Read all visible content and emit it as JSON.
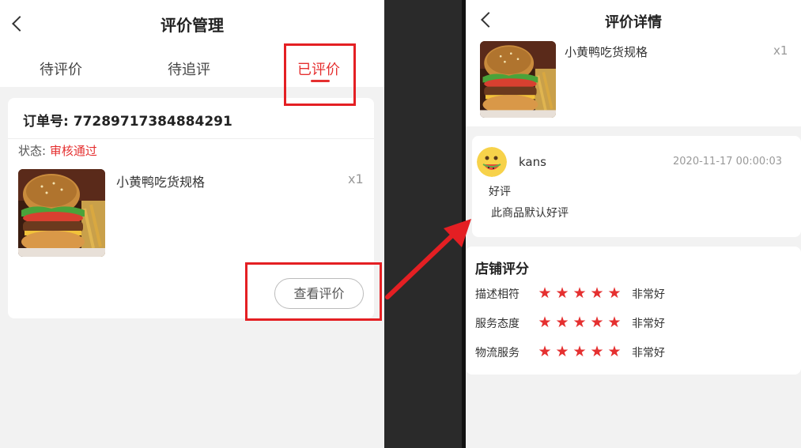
{
  "left": {
    "title": "评价管理",
    "tabs": [
      {
        "label": "待评价",
        "active": false
      },
      {
        "label": "待追评",
        "active": false
      },
      {
        "label": "已评价",
        "active": true
      }
    ],
    "order": {
      "number": "订单号: 77289717384884291",
      "status_label": "状态:",
      "status_value": "审核通过",
      "product_name": "小黄鸭吃货规格",
      "quantity": "x1",
      "view_button": "查看评价"
    }
  },
  "right": {
    "title": "评价详情",
    "product_name": "小黄鸭吃货规格",
    "quantity": "x1",
    "review": {
      "user": "kans",
      "date": "2020-11-17 00:00:03",
      "rating": "好评",
      "content": "此商品默认好评"
    },
    "shop_rating": {
      "title": "店铺评分",
      "rows": [
        {
          "label": "描述相符",
          "stars": 5,
          "text": "非常好"
        },
        {
          "label": "服务态度",
          "stars": 5,
          "text": "非常好"
        },
        {
          "label": "物流服务",
          "stars": 5,
          "text": "非常好"
        }
      ]
    }
  },
  "colors": {
    "accent": "#e53030",
    "highlight": "#e41f23",
    "star": "#e53030",
    "background": "#f2f2f2",
    "divider": "#2a2a2a"
  },
  "icons": {
    "back": "chevron-left-icon",
    "star": "star-icon",
    "avatar": "avatar-icon",
    "burger": "burger-image"
  }
}
